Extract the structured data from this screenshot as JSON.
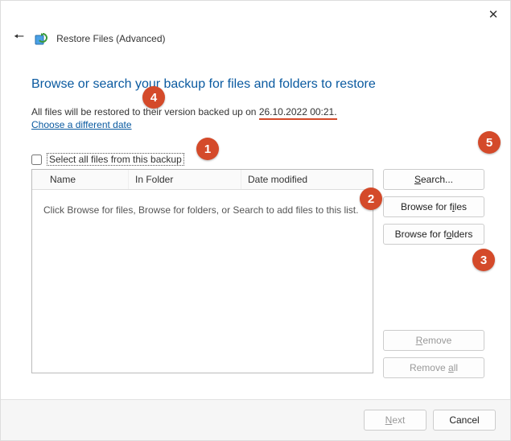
{
  "window": {
    "title": "Restore Files (Advanced)"
  },
  "heading": "Browse or search your backup for files and folders to restore",
  "restore_prefix": "All files will be restored to their version backed up on ",
  "restore_timestamp": "26.10.2022 00:21.",
  "choose_date": "Choose a different date",
  "select_all": "Select all files from this backup",
  "columns": {
    "name": "Name",
    "folder": "In Folder",
    "date": "Date modified"
  },
  "empty_text": "Click Browse for files, Browse for folders, or Search to add files to this list.",
  "buttons": {
    "search": "Search...",
    "browse_files": "Browse for files",
    "browse_folders": "Browse for folders",
    "remove": "Remove",
    "remove_all": "Remove all",
    "next": "Next",
    "cancel": "Cancel"
  },
  "accel": {
    "search_u": "S",
    "files_u": "i",
    "folders_u": "o",
    "remove_u": "R",
    "remove_all_u": "a",
    "next_u": "N"
  },
  "markers": {
    "m1": "1",
    "m2": "2",
    "m3": "3",
    "m4": "4",
    "m5": "5"
  }
}
